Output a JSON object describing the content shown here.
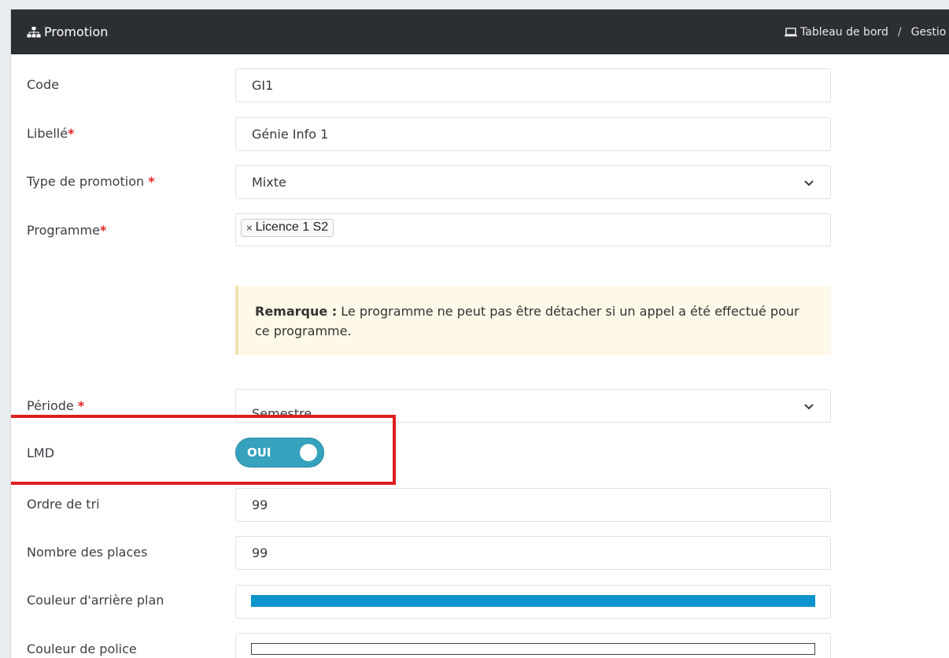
{
  "header": {
    "title": "Promotion",
    "breadcrumb": [
      "Tableau de bord",
      "Gestio"
    ]
  },
  "form": {
    "code": {
      "label": "Code",
      "value": "GI1"
    },
    "libelle": {
      "label": "Libellé",
      "value": "Génie Info 1"
    },
    "type_promotion": {
      "label": "Type de promotion",
      "value": "Mixte"
    },
    "programme": {
      "label": "Programme",
      "tag": "Licence 1 S2",
      "tag_remove": "×"
    },
    "note": {
      "title": "Remarque :",
      "text": " Le programme ne peut pas être détacher si un appel a été effectué pour ce programme."
    },
    "periode": {
      "label": "Période",
      "value": "Semestre"
    },
    "lmd": {
      "label": "LMD",
      "toggle_label": "OUI",
      "checked": true
    },
    "ordre_tri": {
      "label": "Ordre de tri",
      "value": "99"
    },
    "nombre_places": {
      "label": "Nombre des places",
      "value": "99"
    },
    "couleur_arriere": {
      "label": "Couleur d'arrière plan",
      "color": "#0c94cc"
    },
    "couleur_police": {
      "label": "Couleur de police",
      "color": "#ffffff"
    },
    "required_mark": "*"
  },
  "colors": {
    "header_bg": "#2b2e33",
    "toggle_on": "#36a2bd",
    "required": "#e02424",
    "highlight": "#de1f1f"
  }
}
